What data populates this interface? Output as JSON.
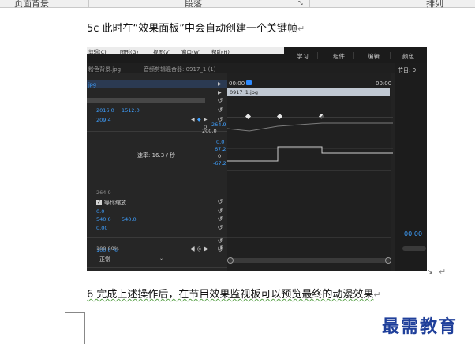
{
  "ribbon": {
    "groups": [
      "页面背景",
      "段落",
      "排列"
    ]
  },
  "doc": {
    "step_5c": "5c 此时在“效果面板”中会自动创建一个关键帧",
    "step_6": "6 完成上述操作后，在节目效果监视板可以预览最终的动漫效果",
    "pilcrow": "↵"
  },
  "app": {
    "menu": [
      "剪辑(C)",
      "图形(G)",
      "视图(V)",
      "窗口(W)",
      "帮助(H)"
    ],
    "workspaces": [
      "学习",
      "组件",
      "编辑",
      "颜色"
    ],
    "source_tab": "粉色背景.jpg",
    "mixer_tab": "音频剪辑混合器: 0917_1 (1)",
    "clip_name_short": "jpg",
    "program_tab": "节目: 0",
    "program_time": "00:00",
    "timeline": {
      "start": "00:00",
      "end": "00:00",
      "clip": "0917_1.jpg"
    },
    "effects": {
      "position_x": "2016.0",
      "position_y": "1512.0",
      "scale": "209.4",
      "scale_zero": "0",
      "graph_max": "264.9",
      "graph_min": "200.0",
      "graph_zero": "0.0",
      "velocity_max": "67.2",
      "velocity_zero": "0",
      "velocity_min": "-67.2",
      "velocity_label": "速率: 16.3 / 秒",
      "rotation": "264.9",
      "uniform_scale_label": "等比缩放",
      "rot_value": "0.0",
      "anchor_x": "540.0",
      "anchor_y": "540.0",
      "flicker": "0.00",
      "opacity": "100.0 %",
      "blend_mode": "正常",
      "time_remap": "100.00%"
    }
  },
  "watermark": "最需教育"
}
